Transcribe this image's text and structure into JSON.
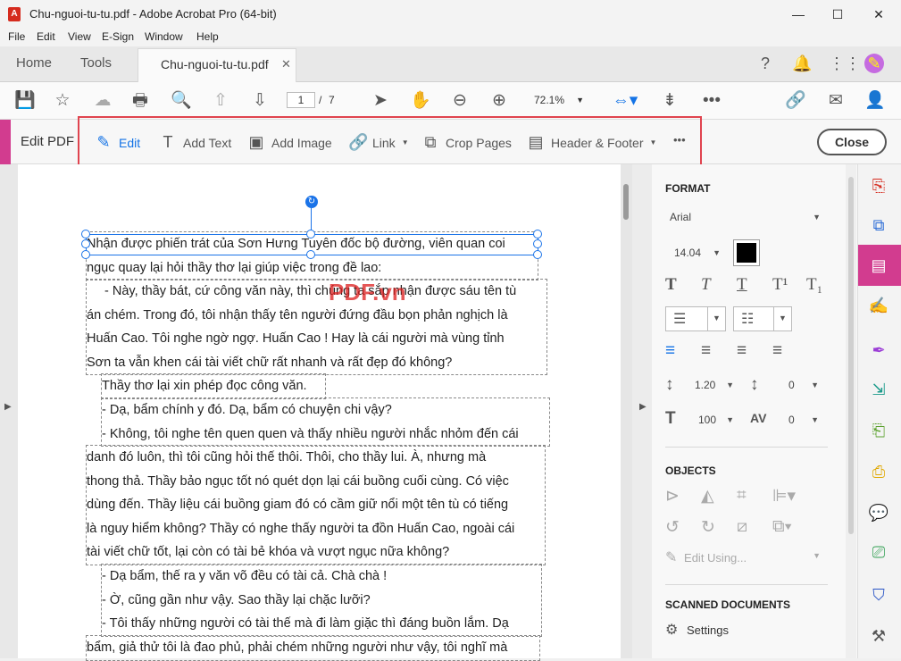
{
  "window": {
    "title": "Chu-nguoi-tu-tu.pdf - Adobe Acrobat Pro (64-bit)",
    "minimize": "—",
    "maximize": "☐",
    "close": "✕"
  },
  "menu": [
    "File",
    "Edit",
    "View",
    "E-Sign",
    "Window",
    "Help"
  ],
  "tabs": {
    "home": "Home",
    "tools": "Tools",
    "document": "Chu-nguoi-tu-tu.pdf",
    "close_glyph": "✕"
  },
  "toolbar": {
    "page_current": "1",
    "page_sep": "/",
    "page_total": "7",
    "zoom": "72.1%"
  },
  "editbar": {
    "title": "Edit PDF",
    "tools": [
      "Edit",
      "Add Text",
      "Add Image",
      "Link",
      "Crop Pages",
      "Header & Footer"
    ],
    "more": "•••",
    "close": "Close"
  },
  "document": {
    "watermark": "PDF.vn",
    "paragraphs": [
      [
        "Nhận được phiến trát của Sơn Hưng Tuyên đốc bộ đường, viên quan coi",
        "ngục quay lại hỏi thầy thơ lại giúp việc trong đề lao:"
      ],
      [
        "- Này, thầy bát, cứ công văn này, thì chúng ta sắp nhận được sáu tên tù",
        "án chém. Trong đó, tôi nhận thấy tên người đứng đầu bọn phản nghịch là",
        "Huấn Cao. Tôi nghe ngờ ngợ. Huấn Cao ! Hay là cái người mà vùng tỉnh",
        "Sơn ta vẫn khen cái tài viết chữ rất nhanh và rất đẹp đó không?"
      ],
      [
        "Thầy thơ lại xin phép đọc công văn."
      ],
      [
        "- Dạ, bẩm chính y đó. Dạ, bẩm có chuyện chi vậy?",
        "- Không, tôi nghe tên quen quen và thấy nhiều người nhắc nhỏm đến cái"
      ],
      [
        "danh đó luôn, thì tôi cũng hỏi thế thôi. Thôi, cho thầy lui. À, nhưng mà",
        "thong thả. Thầy bảo ngục tốt nó quét dọn lại cái buồng cuối cùng. Có việc",
        "dùng đến. Thầy liệu cái buồng giam đó có cầm giữ nổi một tên tù có tiếng",
        "là nguy hiểm không? Thầy có nghe thấy người ta đồn Huấn Cao, ngoài cái",
        "tài viết chữ tốt, lại còn có tài bẻ khóa và vượt ngục nữa không?"
      ],
      [
        "- Dạ bẩm, thế ra y văn võ đều có tài cả. Chà chà !",
        "- Ờ, cũng gần như vậy. Sao thầy lại chặc lưỡi?",
        "- Tôi thấy những người có tài thế mà đi làm giặc thì đáng buồn lắm. Dạ"
      ],
      [
        "bẩm, giả thử tôi là đao phủ, phải chém những người như vậy, tôi nghĩ mà"
      ]
    ]
  },
  "panel": {
    "format_heading": "FORMAT",
    "font": "Arial",
    "font_size": "14.04",
    "font_color": "#000000",
    "line_spacing": "1.20",
    "para_spacing": "0",
    "scale": "100",
    "char_spacing": "0",
    "objects_heading": "OBJECTS",
    "edit_using": "Edit Using...",
    "scanned_heading": "SCANNED DOCUMENTS",
    "settings": "Settings"
  },
  "colors": {
    "accent": "#d23c8f",
    "link_blue": "#1473e6",
    "highlight_red": "#e0444f"
  }
}
